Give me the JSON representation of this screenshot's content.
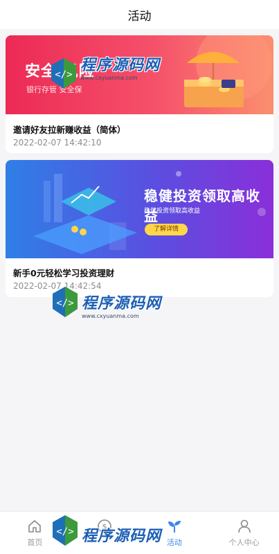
{
  "header": {
    "title": "活动"
  },
  "activities": [
    {
      "title": "邀请好友拉新赚收益（简体）",
      "date": "2022-02-07 14:42:10",
      "banner": {
        "headline": "安全 风险",
        "subtext": "银行存管 安全保"
      }
    },
    {
      "title": "新手0元轻松学习投资理财",
      "date": "2022-02-07 14:42:54",
      "banner": {
        "headline": "稳健投资领取高收益",
        "subtext": "稳健投资领取高收益",
        "button": "了解详情"
      }
    }
  ],
  "watermark": {
    "text": "程序源码网",
    "url": "www.cxyuanma.com"
  },
  "tabbar": {
    "items": [
      {
        "label": "首页",
        "icon": "home-icon"
      },
      {
        "label": "",
        "icon": "dollar-icon"
      },
      {
        "label": "活动",
        "icon": "sprout-icon",
        "active": true
      },
      {
        "label": "个人中心",
        "icon": "person-icon"
      }
    ]
  },
  "colors": {
    "accent": "#3f86e8",
    "inactive": "#999999"
  }
}
